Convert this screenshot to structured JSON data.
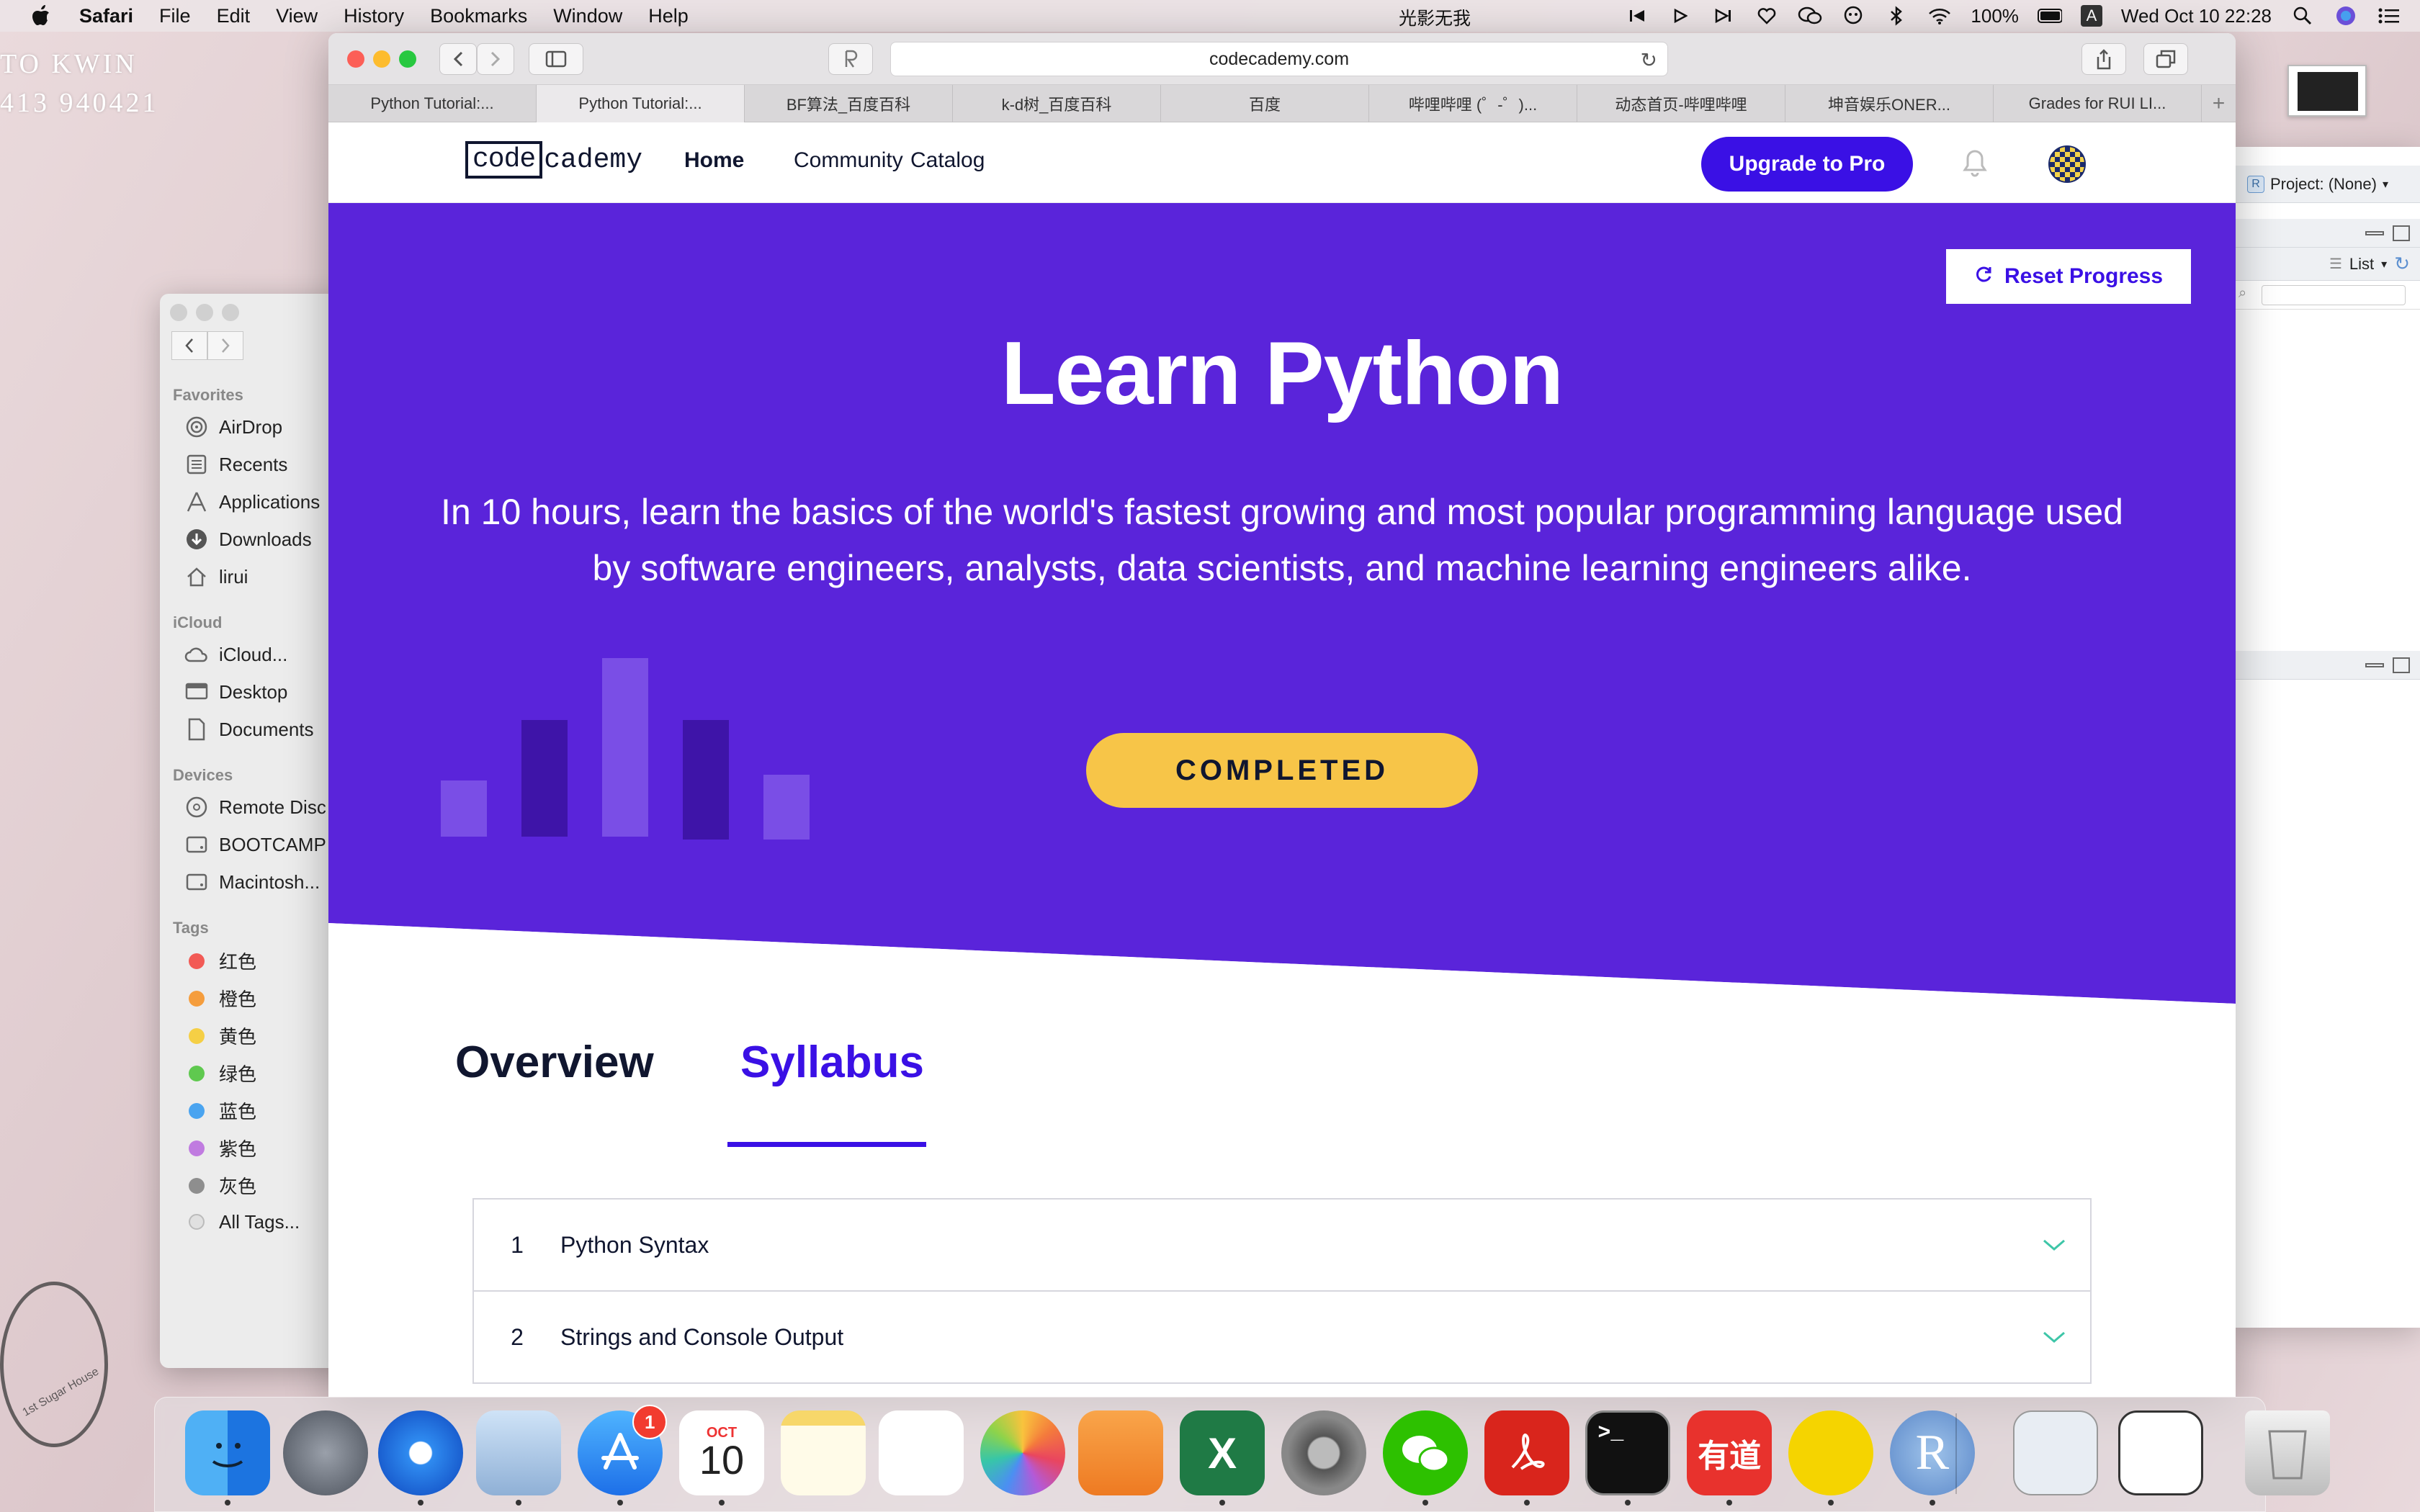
{
  "menubar": {
    "app": "Safari",
    "items": [
      "File",
      "Edit",
      "View",
      "History",
      "Bookmarks",
      "Window",
      "Help"
    ],
    "center_app": "光影无我",
    "battery": "100%",
    "ime": "A",
    "datetime": "Wed Oct 10  22:28"
  },
  "desktop": {
    "line1": "TO  KWIN",
    "line2": "413 940421",
    "stamp": "1st Sugar House"
  },
  "finder": {
    "favorites_title": "Favorites",
    "favorites": [
      "AirDrop",
      "Recents",
      "Applications",
      "Downloads",
      "lirui"
    ],
    "icloud_title": "iCloud",
    "icloud": [
      "iCloud...",
      "Desktop",
      "Documents"
    ],
    "devices_title": "Devices",
    "devices": [
      "Remote Disc",
      "BOOTCAMP",
      "Macintosh..."
    ],
    "tags_title": "Tags",
    "tags": [
      {
        "label": "红色",
        "color": "#f25a55"
      },
      {
        "label": "橙色",
        "color": "#f59d3d"
      },
      {
        "label": "黄色",
        "color": "#f5cf45"
      },
      {
        "label": "绿色",
        "color": "#5fc94f"
      },
      {
        "label": "蓝色",
        "color": "#4aa4f0"
      },
      {
        "label": "紫色",
        "color": "#c07be0"
      },
      {
        "label": "灰色",
        "color": "#8e8e8e"
      },
      {
        "label": "All Tags...",
        "color": "#e0e0e0"
      }
    ]
  },
  "rstudio": {
    "project": "Project: (None)",
    "list": "List"
  },
  "safari": {
    "url": "codecademy.com",
    "tabs": [
      "Python Tutorial:...",
      "Python Tutorial:...",
      "BF算法_百度百科",
      "k-d树_百度百科",
      "百度",
      "哔哩哔哩 (゜-゜)...",
      "动态首页-哔哩哔哩",
      "坤音娱乐ONER...",
      "Grades for RUI LI..."
    ]
  },
  "page": {
    "logo_left": "code",
    "logo_right": "cademy",
    "nav": {
      "home": "Home",
      "community": "Community",
      "catalog": "Catalog"
    },
    "upgrade": "Upgrade to Pro",
    "reset": "Reset Progress",
    "title": "Learn Python",
    "description": "In 10 hours, learn the basics of the world's fastest growing and most popular programming language used by software engineers, analysts, data scientists, and machine learning engineers alike.",
    "status": "COMPLETED",
    "tabs": {
      "overview": "Overview",
      "syllabus": "Syllabus"
    },
    "syllabus": [
      {
        "num": "1",
        "title": "Python Syntax"
      },
      {
        "num": "2",
        "title": "Strings and Console Output"
      }
    ],
    "colors": {
      "brand": "#3a10e5",
      "hero": "#5a24da",
      "button": "#f7c548"
    }
  },
  "dock": {
    "apps": [
      "finder-icon",
      "launchpad-icon",
      "safari-icon",
      "preview-icon",
      "app-store-icon",
      "calendar-icon",
      "notes-icon",
      "reminders-icon",
      "photos-icon",
      "pages-icon",
      "excel-icon",
      "system-preferences-icon",
      "wechat-icon",
      "acrobat-icon",
      "terminal-icon",
      "youdao-icon",
      "qq-music-icon",
      "r-icon",
      "screenshot-doc-icon",
      "screenshot-window-icon",
      "trash-icon"
    ],
    "appstore_badge": "1",
    "calendar_month": "OCT",
    "calendar_day": "10",
    "terminal_prompt": ">_",
    "youdao_text": "有道",
    "r_text": "R",
    "excel_text": "X"
  }
}
